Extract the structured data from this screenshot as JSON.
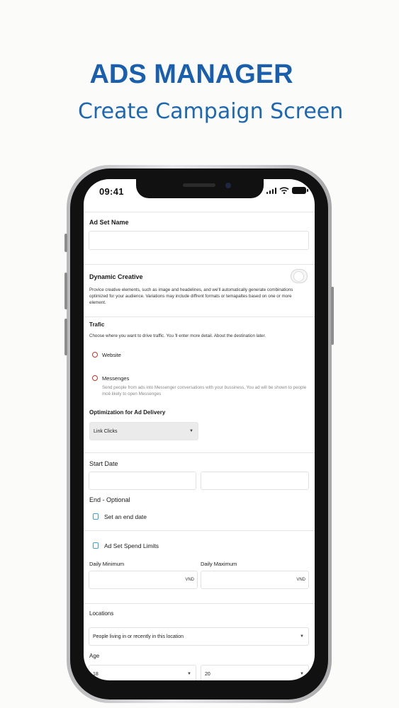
{
  "promo": {
    "title": "ADS MANAGER",
    "subtitle": "Create Campaign Screen"
  },
  "status_bar": {
    "time": "09:41"
  },
  "form": {
    "ad_set_name_label": "Ad Set Name",
    "ad_set_name_value": "",
    "dynamic_creative": {
      "label": "Dynamic Creative",
      "description": "Provice creative elements, such as image and headelines, and we'll automatically generate combinations optimized for your audience. Variations may include diffrent formats or temapaltes based on one or more element.",
      "enabled": false
    },
    "traffic": {
      "label": "Trafic",
      "description": "Choose where you want to drive traffic. You 'll enter more detail. About the destination later.",
      "options": [
        {
          "label": "Website",
          "description": ""
        },
        {
          "label": "Messenges",
          "description": "Send people from ads into Messenger conversations with your bussiness, You ad will be shown to people moê likely to open Messenges"
        }
      ]
    },
    "optimization": {
      "label": "Optimization for Ad Delivery",
      "selected": "Link Clicks"
    },
    "start_date_label": "Start Date",
    "end_date": {
      "label": "End - Optional",
      "checkbox_label": "Set an end date"
    },
    "spend_limits": {
      "checkbox_label": "Ad Set Spend Limits",
      "daily_min_label": "Daily Minimum",
      "daily_max_label": "Daily Maximum",
      "currency": "VND"
    },
    "locations": {
      "label": "Locations",
      "selected": "People living in or recently in this location"
    },
    "age": {
      "label": "Age",
      "min": "18",
      "max": "20"
    }
  },
  "colors": {
    "brand_blue": "#1a5fae",
    "radio_red": "#c0392b",
    "checkbox_teal": "#3aa6c8"
  }
}
